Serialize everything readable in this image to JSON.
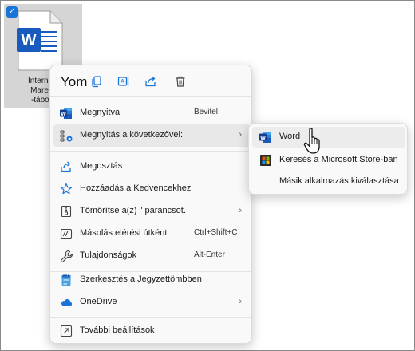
{
  "file": {
    "name_lines": [
      "Internet",
      "Marek",
      "-tábor"
    ],
    "checked": true,
    "icon": "word-document-icon"
  },
  "menu": {
    "header_name": "Yom",
    "top_actions": [
      {
        "icon": "copy-icon"
      },
      {
        "icon": "rename-icon"
      },
      {
        "icon": "share-icon"
      },
      {
        "icon": "trash-icon"
      }
    ],
    "items": [
      {
        "label": "Megnyitva",
        "shortcut": "Bevitel",
        "icon": "word-icon"
      },
      {
        "label": "Megnyitás a következővel:",
        "shortcut": "",
        "icon": "open-with-icon",
        "submenu": true
      },
      {
        "label": "Megosztás",
        "shortcut": "",
        "icon": "share-icon"
      },
      {
        "label": "Hozzáadás a Kedvencekhez",
        "shortcut": "",
        "icon": "star-icon"
      },
      {
        "label": "Tömörítse a(z) \" parancsot.",
        "shortcut": "",
        "icon": "zip-icon",
        "submenu": true
      },
      {
        "label": "Másolás elérési útként",
        "shortcut": "Ctrl+Shift+C",
        "icon": "copy-path-icon"
      },
      {
        "label": "Tulajdonságok",
        "shortcut": "Alt-Enter",
        "icon": "wrench-icon"
      },
      {
        "label": "Szerkesztés a Jegyzettömbben",
        "shortcut": "",
        "icon": "notepad-icon"
      },
      {
        "label": "OneDrive",
        "shortcut": "",
        "icon": "onedrive-icon",
        "submenu": true
      },
      {
        "label": "További beállítások",
        "shortcut": "",
        "icon": "more-options-icon"
      }
    ]
  },
  "submenu": {
    "items": [
      {
        "label": "Word",
        "icon": "word-icon"
      },
      {
        "label": "Keresés a Microsoft Store-ban",
        "icon": "store-icon"
      },
      {
        "label": "Másik alkalmazás kiválasztása",
        "icon": ""
      }
    ]
  },
  "colors": {
    "word_blue": "#185abd",
    "accent": "#1a73d9",
    "menu_bg": "#f9f9f9",
    "hover_bg": "#e8e8e8"
  }
}
